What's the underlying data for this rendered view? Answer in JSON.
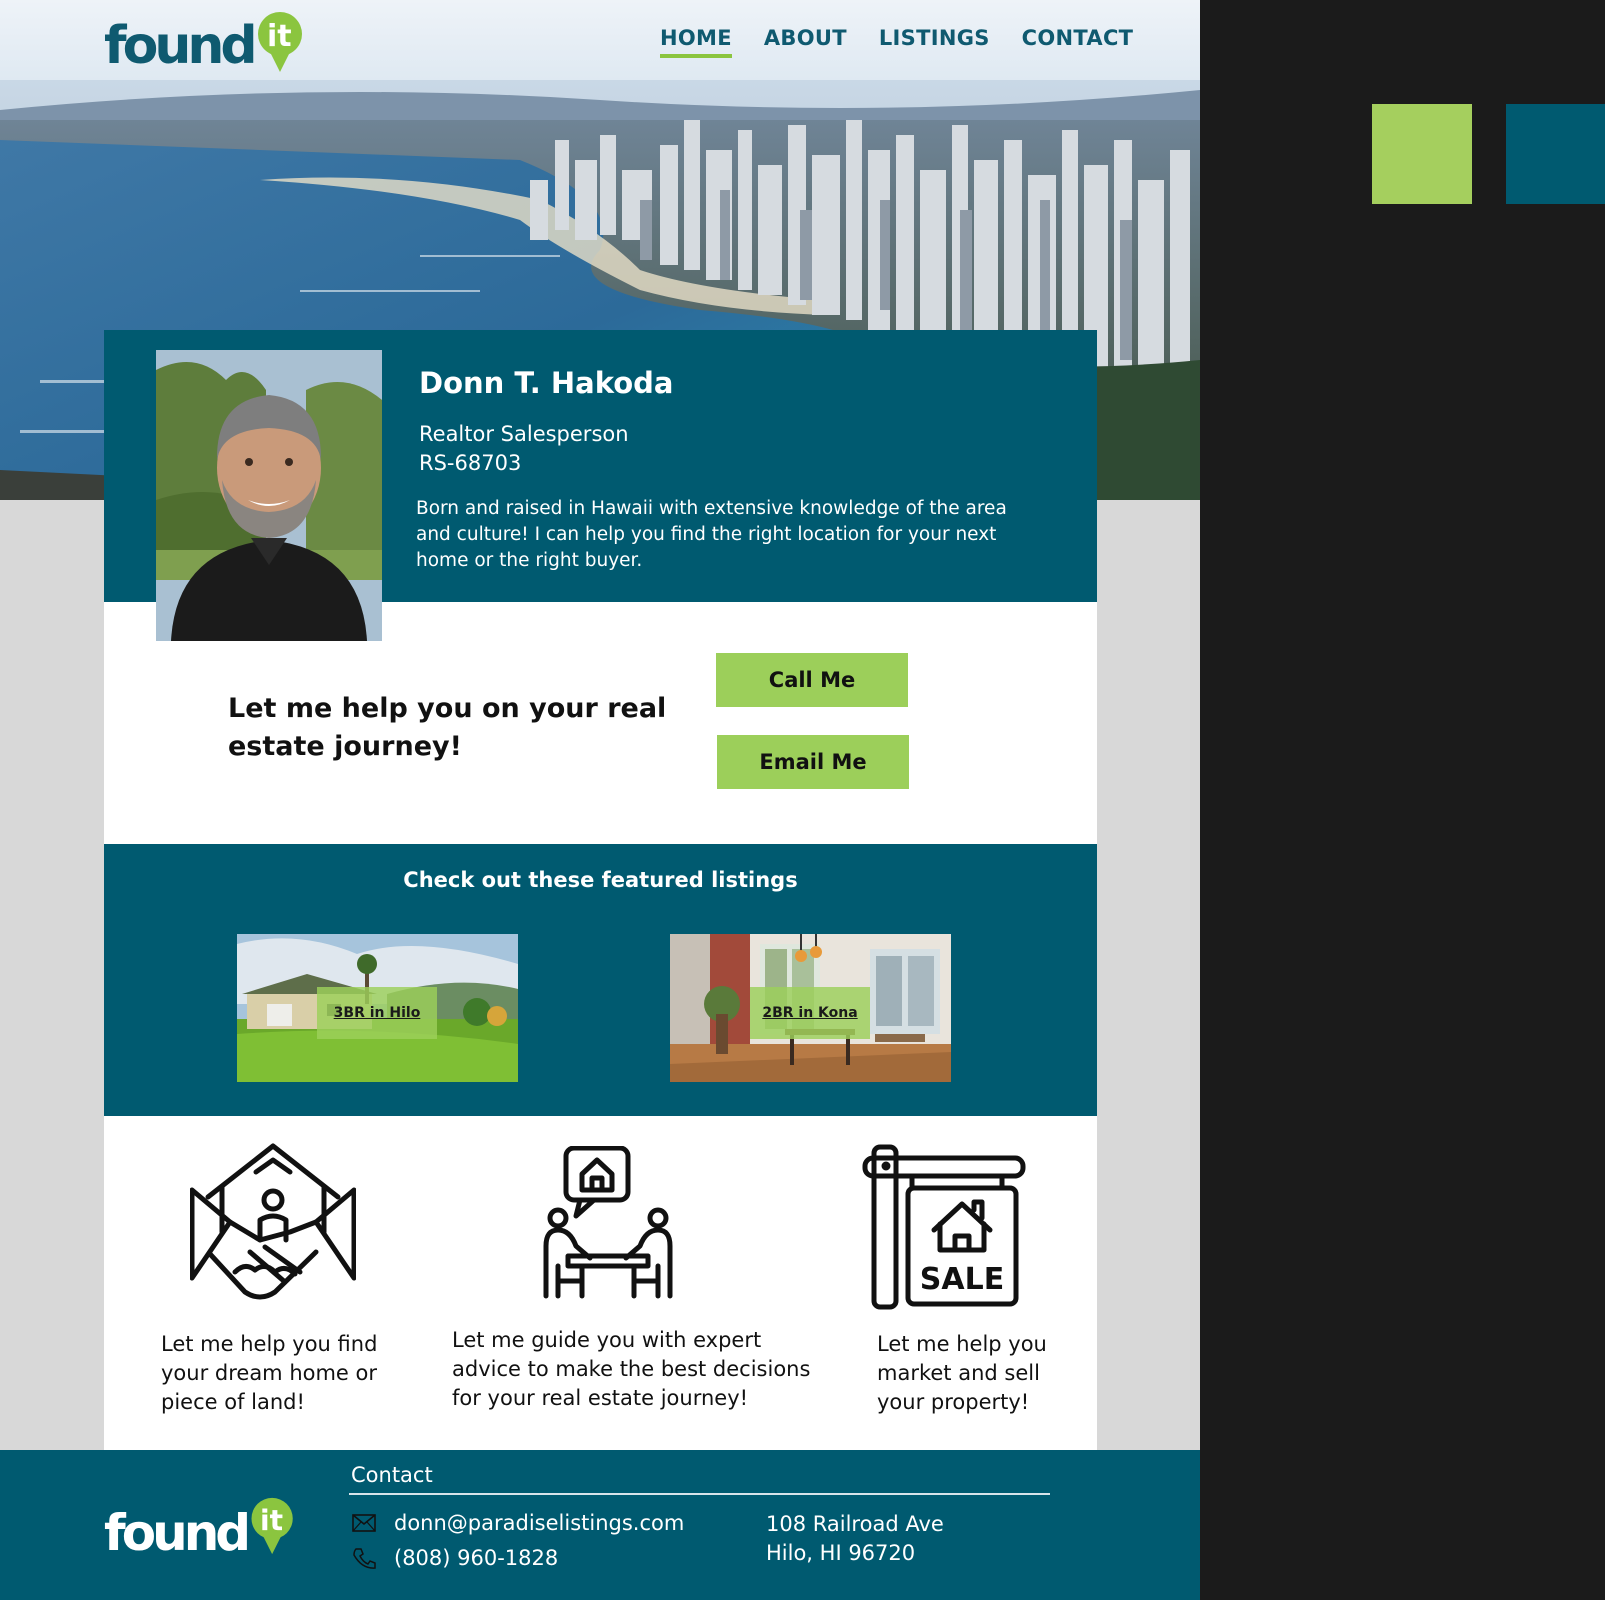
{
  "brand": {
    "logo_word": "found",
    "logo_suffix": "it"
  },
  "nav": {
    "items": [
      "HOME",
      "ABOUT",
      "LISTINGS",
      "CONTACT"
    ],
    "active": "HOME"
  },
  "profile": {
    "name": "Donn T. Hakoda",
    "title": "Realtor Salesperson",
    "license": "RS-68703",
    "bio": "Born and raised in Hawaii with extensive knowledge of the area and culture! I can help you find the right location for your next home or the right buyer."
  },
  "cta": {
    "headline": "Let me help you on your real estate journey!",
    "call_label": "Call Me",
    "email_label": "Email Me"
  },
  "featured": {
    "title": "Check out these featured listings",
    "listings": [
      {
        "label": "3BR in Hilo"
      },
      {
        "label": "2BR in Kona"
      }
    ]
  },
  "services": [
    {
      "icon": "handshake-house-icon",
      "text": "Let me help you find your dream home or piece of land!"
    },
    {
      "icon": "consultation-icon",
      "text": "Let me guide you with expert advice to make the best decisions for your real estate journey!"
    },
    {
      "icon": "sale-sign-icon",
      "text": "Let me help you market and sell your property!",
      "sign_text": "SALE"
    }
  ],
  "footer": {
    "contact_heading": "Contact",
    "email": "donn@paradiselistings.com",
    "phone": "(808) 960-1828",
    "address_line1": "108 Railroad Ave",
    "address_line2": "Hilo, HI  96720"
  },
  "colors": {
    "teal": "#005a70",
    "green": "#9ccf5a",
    "dark_bg": "#1b1b1b"
  }
}
